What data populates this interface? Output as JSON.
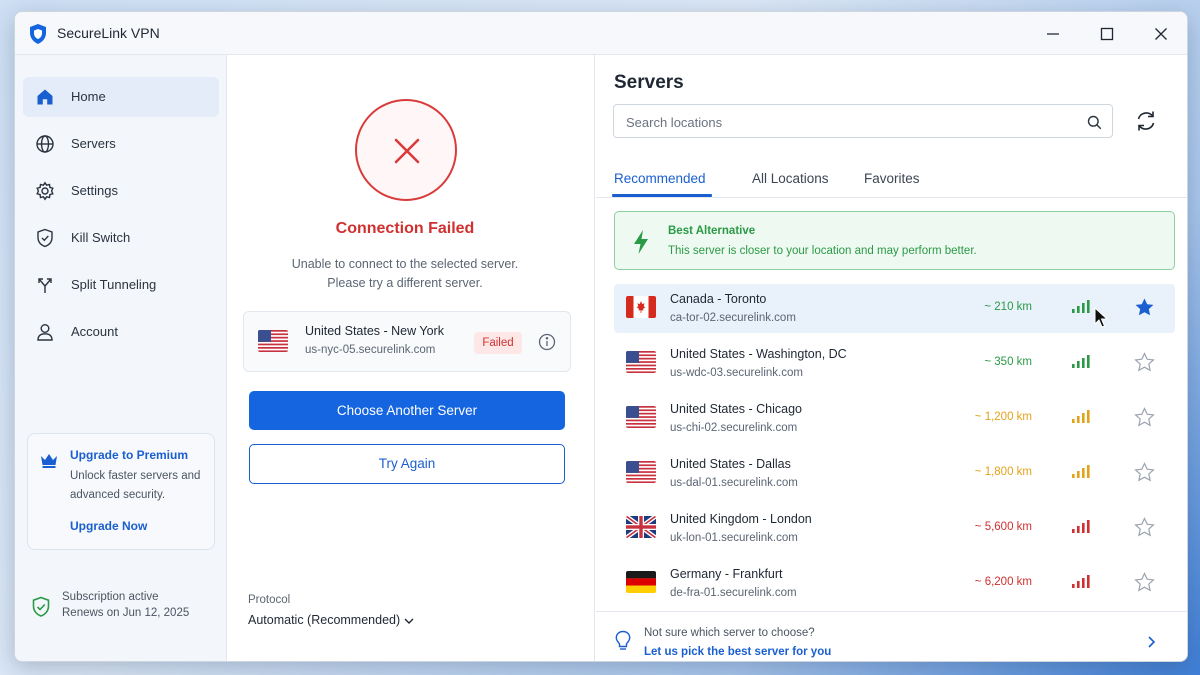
{
  "app": {
    "title": "SecureLink VPN",
    "accent_color": "#1565e0",
    "error_color": "#d0302f",
    "success_color": "#2b9a46"
  },
  "window_controls": [
    "minimize-icon",
    "maximize-icon",
    "close-icon"
  ],
  "sidebar": {
    "items": [
      {
        "label": "Home",
        "icon": "home-icon",
        "active": true
      },
      {
        "label": "Servers",
        "icon": "globe-icon",
        "active": false
      },
      {
        "label": "Settings",
        "icon": "gear-icon",
        "active": false
      },
      {
        "label": "Kill Switch",
        "icon": "shield-icon",
        "active": false
      },
      {
        "label": "Split Tunneling",
        "icon": "split-arrows-icon",
        "active": false
      },
      {
        "label": "Account",
        "icon": "user-icon",
        "active": false
      }
    ],
    "premium": {
      "title": "Upgrade to Premium",
      "description": "Unlock faster servers and advanced security.",
      "link": "Upgrade Now",
      "icon": "crown-icon"
    },
    "subscription": {
      "status": "Subscription active",
      "renewal": "Renews on Jun 12, 2025",
      "icon": "shield-check-icon"
    }
  },
  "connection": {
    "title": "Connection Failed",
    "message_line1": "Unable to connect to the selected server.",
    "message_line2": "Please try a different server.",
    "server": {
      "name": "United States - New York",
      "host": "us-nyc-05.securelink.com",
      "status": "Failed",
      "flag": "us"
    },
    "primary_button": "Choose Another Server",
    "secondary_button": "Try Again",
    "protocol_label": "Protocol",
    "protocol_value": "Automatic (Recommended)"
  },
  "servers": {
    "title": "Servers",
    "search_placeholder": "Search locations",
    "tabs": [
      {
        "label": "Recommended",
        "active": true
      },
      {
        "label": "All Locations",
        "active": false
      },
      {
        "label": "Favorites",
        "active": false
      }
    ],
    "alternative": {
      "title": "Best Alternative",
      "description": "This server is closer to your location and may perform better."
    },
    "list": [
      {
        "name": "Canada - Toronto",
        "host": "ca-tor-02.securelink.com",
        "distance": "~ 210 km",
        "flag": "ca",
        "signal": "good",
        "favorite": true,
        "selected": true
      },
      {
        "name": "United States - Washington, DC",
        "host": "us-wdc-03.securelink.com",
        "distance": "~ 350 km",
        "flag": "us",
        "signal": "good",
        "favorite": false,
        "selected": false
      },
      {
        "name": "United States - Chicago",
        "host": "us-chi-02.securelink.com",
        "distance": "~ 1,200 km",
        "flag": "us",
        "signal": "medium",
        "favorite": false,
        "selected": false
      },
      {
        "name": "United States - Dallas",
        "host": "us-dal-01.securelink.com",
        "distance": "~ 1,800 km",
        "flag": "us",
        "signal": "medium",
        "favorite": false,
        "selected": false
      },
      {
        "name": "United Kingdom - London",
        "host": "uk-lon-01.securelink.com",
        "distance": "~ 5,600 km",
        "flag": "uk",
        "signal": "poor",
        "favorite": false,
        "selected": false
      },
      {
        "name": "Germany - Frankfurt",
        "host": "de-fra-01.securelink.com",
        "distance": "~ 6,200 km",
        "flag": "de",
        "signal": "poor",
        "favorite": false,
        "selected": false
      }
    ],
    "signal_colors": {
      "good": "#2b9a46",
      "medium": "#e3a21a",
      "poor": "#d0302f"
    },
    "hint": {
      "question": "Not sure which server to choose?",
      "link": "Let us pick the best server for you"
    }
  }
}
